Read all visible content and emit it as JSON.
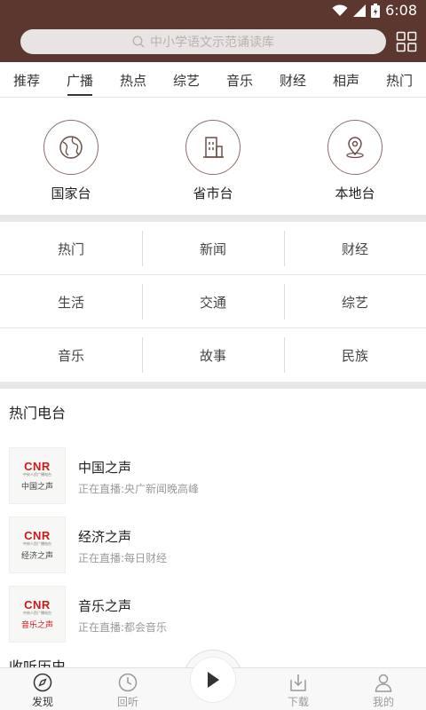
{
  "status": {
    "time": "6:08"
  },
  "search": {
    "placeholder": "中小学语文示范诵读库"
  },
  "tabs": [
    "推荐",
    "广播",
    "热点",
    "综艺",
    "音乐",
    "财经",
    "相声",
    "热门"
  ],
  "active_tab": "广播",
  "categories": [
    {
      "label": "国家台",
      "icon": "globe-icon"
    },
    {
      "label": "省市台",
      "icon": "building-icon"
    },
    {
      "label": "本地台",
      "icon": "location-pin-icon"
    }
  ],
  "genres": [
    [
      "热门",
      "新闻",
      "财经"
    ],
    [
      "生活",
      "交通",
      "综艺"
    ],
    [
      "音乐",
      "故事",
      "民族"
    ]
  ],
  "hot_stations": {
    "title": "热门电台",
    "items": [
      {
        "name": "中国之声",
        "now": "正在直播:央广新闻晚高峰",
        "logo_brand": "CNR",
        "logo_sub": "中央人民广播电台",
        "logo_name": "中国之声"
      },
      {
        "name": "经济之声",
        "now": "正在直播:每日财经",
        "logo_brand": "CNR",
        "logo_sub": "中央人民广播电台",
        "logo_name": "经济之声"
      },
      {
        "name": "音乐之声",
        "now": "正在直播:都会音乐",
        "logo_brand": "CNR",
        "logo_sub": "中央人民广播电台",
        "logo_name": "音乐之声"
      }
    ]
  },
  "history": {
    "title": "收听历史"
  },
  "bottom_nav": {
    "items": [
      {
        "label": "发现",
        "icon": "compass-icon",
        "active": true
      },
      {
        "label": "回听",
        "icon": "clock-icon",
        "active": false
      },
      {
        "label": "下载",
        "icon": "download-icon",
        "active": false
      },
      {
        "label": "我的",
        "icon": "user-icon",
        "active": false
      }
    ],
    "play_icon": "play-icon"
  },
  "colors": {
    "header": "#5b3730",
    "accent_red": "#d0171c",
    "icon_stroke": "#8a6f69"
  }
}
